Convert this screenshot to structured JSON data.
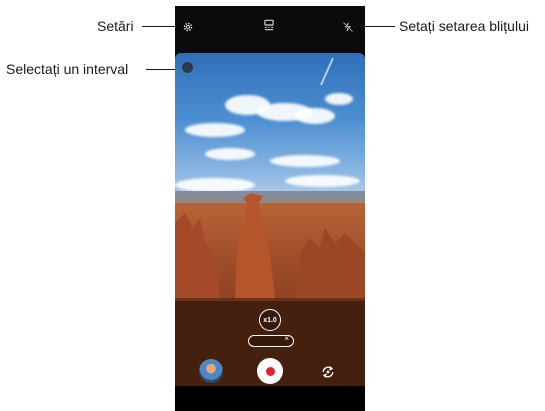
{
  "callouts": {
    "settings": "Setări",
    "select_range": "Selectați un interval",
    "flash": "Setați setarea blițului"
  },
  "camera": {
    "zoom_label": "x1.0",
    "top_icons": [
      "gear-icon",
      "aspect-ratio-icon",
      "flash-off-icon"
    ],
    "bottom_icons": [
      "gallery-thumbnail",
      "record-button",
      "switch-camera-icon"
    ]
  },
  "colors": {
    "record_red": "#e0242c",
    "phone_black": "#0b0b0b"
  }
}
